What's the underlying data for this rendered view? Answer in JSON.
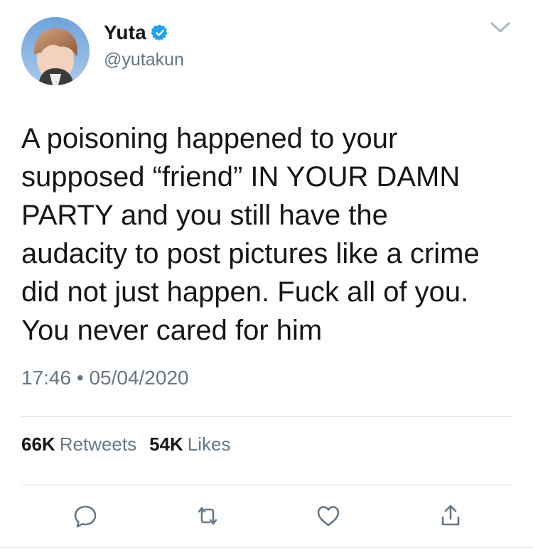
{
  "tweet": {
    "author": {
      "display_name": "Yuta",
      "handle": "@yutakun",
      "verified": true
    },
    "text": "A poisoning happened to your\nsupposed “friend” IN YOUR DAMN\nPARTY and you still have the\naudacity to post pictures like a crime\ndid not just happen. Fuck all of you.\nYou never cared for him",
    "time": "17:46",
    "separator": "•",
    "date": "05/04/2020",
    "stats": {
      "retweets_count": "66K",
      "retweets_label": "Retweets",
      "likes_count": "54K",
      "likes_label": "Likes"
    },
    "icons": {
      "reply": "reply-icon",
      "retweet": "retweet-icon",
      "like": "like-icon",
      "share": "share-icon",
      "menu": "chevron-down-icon",
      "verified": "verified-badge-icon"
    },
    "colors": {
      "verified_blue": "#1da1f2",
      "text": "#14171a",
      "secondary_text": "#657786",
      "icon_gray": "#657786",
      "divider": "#d8dde2"
    }
  }
}
